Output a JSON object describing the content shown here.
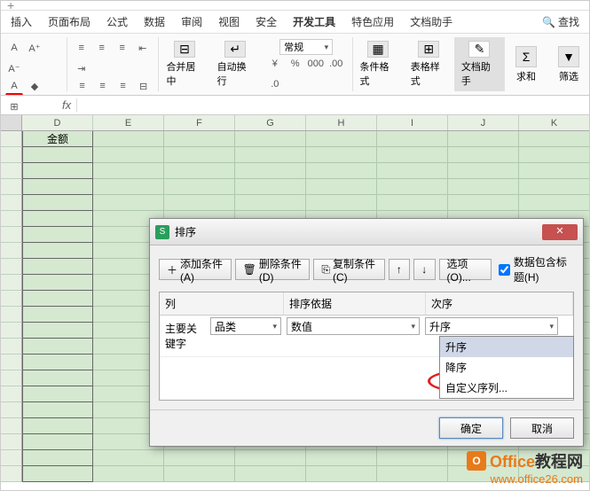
{
  "tabs": [
    "插入",
    "页面布局",
    "公式",
    "数据",
    "审阅",
    "视图",
    "安全",
    "开发工具",
    "特色应用",
    "文档助手"
  ],
  "search_placeholder": "查找",
  "tab_add": "+",
  "number_format": "常规",
  "ribbon": {
    "merge": "合并居中",
    "wrap": "自动换行",
    "cond_format": "条件格式",
    "table_style": "表格样式",
    "doc_helper": "文档助手",
    "sum": "求和",
    "filter": "筛选"
  },
  "number_icons": [
    "¥",
    "%",
    "000",
    ".00",
    ".0"
  ],
  "fx": "fx",
  "columns": [
    "D",
    "E",
    "F",
    "G",
    "H",
    "I",
    "J",
    "K"
  ],
  "first_cell": "金额",
  "dialog": {
    "title": "排序",
    "add_cond": "添加条件(A)",
    "del_cond": "删除条件(D)",
    "copy_cond": "复制条件(C)",
    "options": "选项(O)...",
    "has_header": "数据包含标题(H)",
    "col_hdr": "列",
    "sort_by_hdr": "排序依据",
    "order_hdr": "次序",
    "primary_key": "主要关键字",
    "col_value": "品类",
    "sort_by_value": "数值",
    "order_value": "升序",
    "opt1": "升序",
    "opt2": "降序",
    "opt3": "自定义序列...",
    "ok": "确定",
    "cancel": "取消",
    "up": "↑",
    "down": "↓"
  },
  "watermark": {
    "brand_prefix": "Office",
    "brand_suffix": "教程网",
    "url": "www.office26.com",
    "icon": "O"
  }
}
